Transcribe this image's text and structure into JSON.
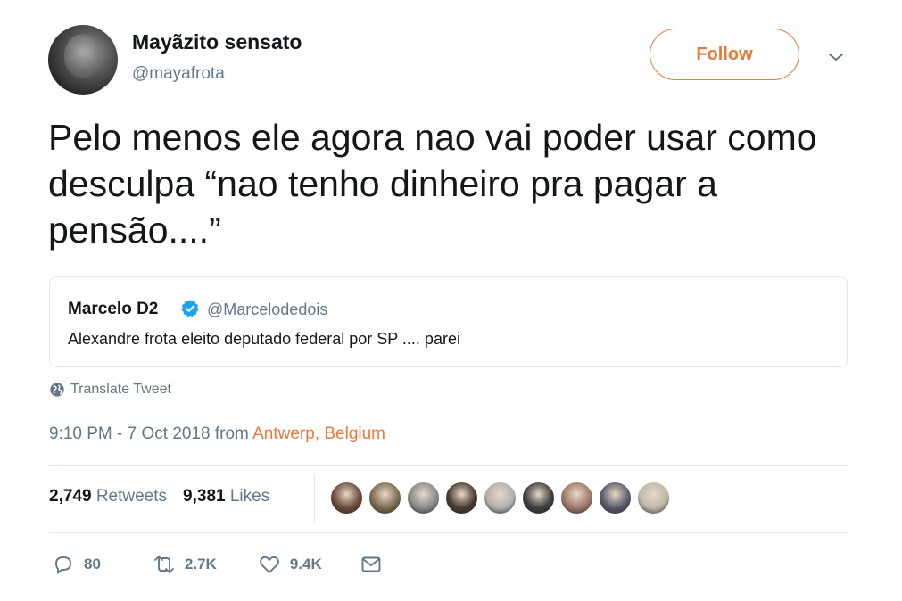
{
  "author": {
    "display_name": "Mayãzito sensato",
    "handle": "@mayafrota"
  },
  "follow_label": "Follow",
  "tweet_text": "Pelo menos ele agora nao vai poder usar como desculpa “nao tenho dinheiro pra pagar a pensão....”",
  "quoted": {
    "display_name": "Marcelo D2",
    "handle": "@Marcelodedois",
    "text": "Alexandre frota eleito deputado federal por SP .... parei"
  },
  "translate_label": "Translate Tweet",
  "timestamp": {
    "time": "9:10 PM - 7 Oct 2018",
    "from_word": "from",
    "location": "Antwerp, Belgium"
  },
  "stats": {
    "retweets_count": "2,749",
    "retweets_label": "Retweets",
    "likes_count": "9,381",
    "likes_label": "Likes"
  },
  "likers": [
    {
      "color": "#6b4a3a"
    },
    {
      "color": "#7d6a4f"
    },
    {
      "color": "#8a8a8a"
    },
    {
      "color": "#4a3a30"
    },
    {
      "color": "#b0b0b0"
    },
    {
      "color": "#3d3d3d"
    },
    {
      "color": "#a07868"
    },
    {
      "color": "#5a5a6a"
    },
    {
      "color": "#c0b8a8"
    }
  ],
  "actions": {
    "reply_count": "80",
    "retweet_count": "2.7K",
    "like_count": "9.4K"
  },
  "colors": {
    "accent": "#e8793a",
    "secondary_text": "#657786",
    "verified": "#1da1f2"
  }
}
